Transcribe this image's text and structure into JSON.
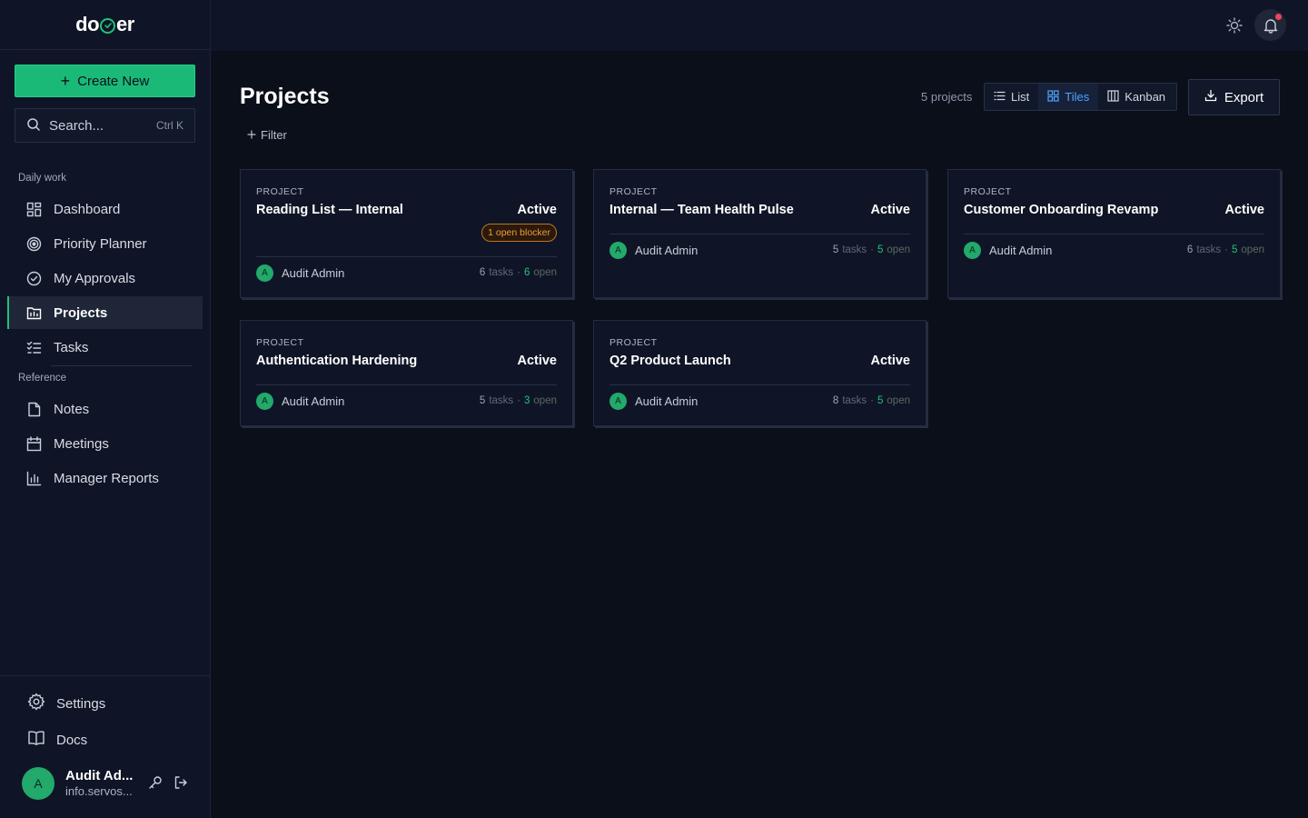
{
  "app": {
    "logo_left": "do",
    "logo_right": "er"
  },
  "sidebar": {
    "create_label": "Create New",
    "search_placeholder": "Search...",
    "search_shortcut": "Ctrl K",
    "section_daily": "Daily work",
    "section_reference": "Reference",
    "daily_items": [
      {
        "label": "Dashboard",
        "icon": "dashboard-icon"
      },
      {
        "label": "Priority Planner",
        "icon": "target-icon"
      },
      {
        "label": "My Approvals",
        "icon": "check-circle-icon"
      },
      {
        "label": "Projects",
        "icon": "projects-icon",
        "active": true
      },
      {
        "label": "Tasks",
        "icon": "tasks-icon"
      }
    ],
    "reference_items": [
      {
        "label": "Notes",
        "icon": "note-icon"
      },
      {
        "label": "Meetings",
        "icon": "calendar-icon"
      },
      {
        "label": "Manager Reports",
        "icon": "bar-chart-icon"
      }
    ],
    "settings_label": "Settings",
    "docs_label": "Docs",
    "user": {
      "initial": "A",
      "name": "Audit Ad...",
      "email": "info.servos..."
    }
  },
  "main": {
    "title": "Projects",
    "filter_label": "Filter",
    "count_label": "5 projects",
    "views": [
      {
        "label": "List",
        "icon": "list-icon"
      },
      {
        "label": "Tiles",
        "icon": "grid-icon",
        "active": true
      },
      {
        "label": "Kanban",
        "icon": "kanban-icon"
      }
    ],
    "export_label": "Export",
    "projects": [
      {
        "kicker": "PROJECT",
        "title": "Reading List — Internal",
        "status": "Active",
        "blocker": "1 open blocker",
        "owner_initial": "A",
        "owner": "Audit Admin",
        "tasks": "6",
        "tasks_label": "tasks",
        "sep": "·",
        "open": "6",
        "open_label": "open"
      },
      {
        "kicker": "PROJECT",
        "title": "Internal — Team Health Pulse",
        "status": "Active",
        "owner_initial": "A",
        "owner": "Audit Admin",
        "tasks": "5",
        "tasks_label": "tasks",
        "sep": "·",
        "open": "5",
        "open_label": "open"
      },
      {
        "kicker": "PROJECT",
        "title": "Customer Onboarding Revamp",
        "status": "Active",
        "owner_initial": "A",
        "owner": "Audit Admin",
        "tasks": "6",
        "tasks_label": "tasks",
        "sep": "·",
        "open": "5",
        "open_label": "open"
      },
      {
        "kicker": "PROJECT",
        "title": "Authentication Hardening",
        "status": "Active",
        "owner_initial": "A",
        "owner": "Audit Admin",
        "tasks": "5",
        "tasks_label": "tasks",
        "sep": "·",
        "open": "3",
        "open_label": "open"
      },
      {
        "kicker": "PROJECT",
        "title": "Q2 Product Launch",
        "status": "Active",
        "owner_initial": "A",
        "owner": "Audit Admin",
        "tasks": "8",
        "tasks_label": "tasks",
        "sep": "·",
        "open": "5",
        "open_label": "open"
      }
    ]
  },
  "colors": {
    "accent": "#1bb978",
    "active_view": "#4fa3ff",
    "blocker": "#f29a3a",
    "notification_dot": "#f0445a"
  }
}
